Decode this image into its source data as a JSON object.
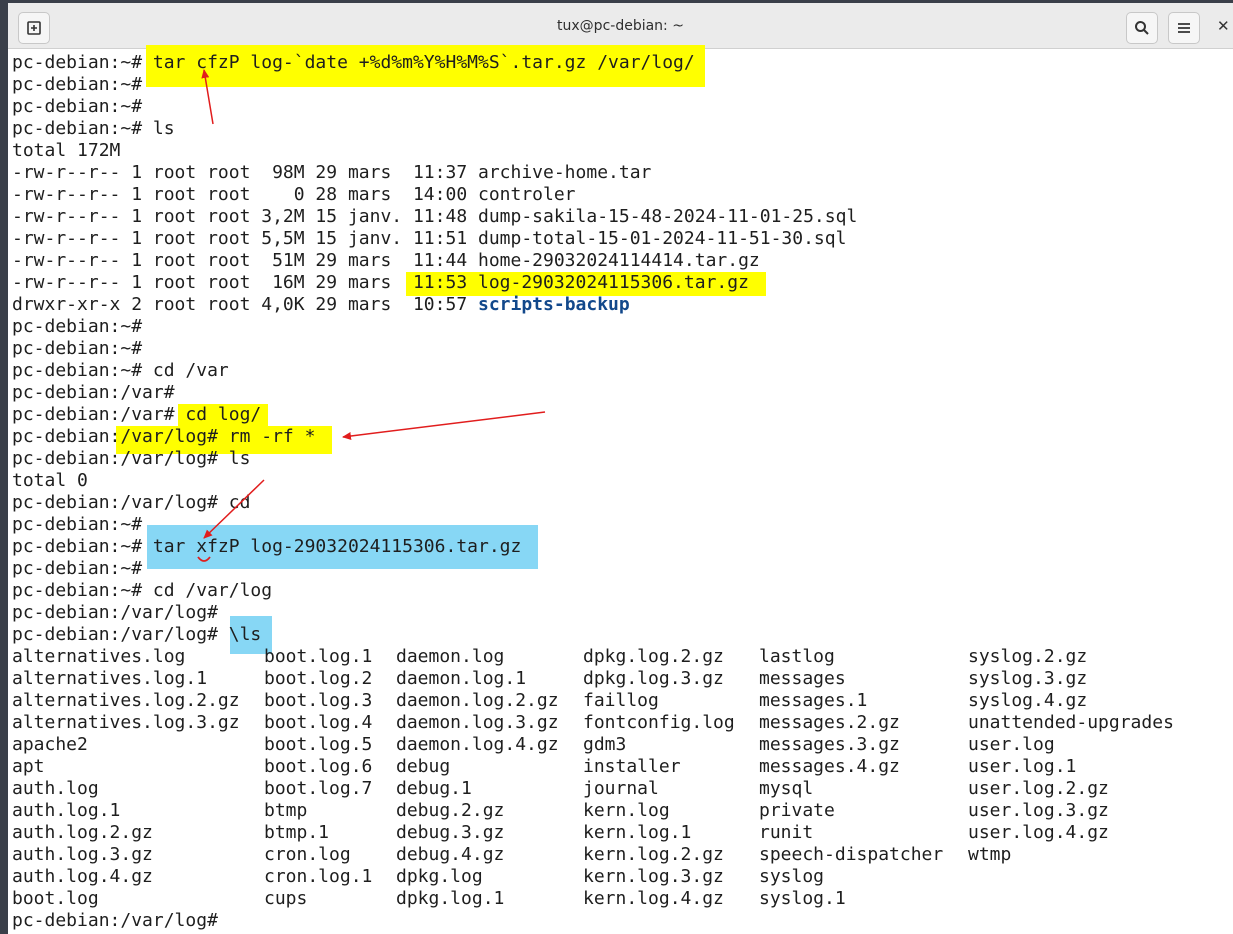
{
  "window": {
    "title": "tux@pc-debian: ~",
    "new_tab_icon": "new-tab-icon",
    "search_icon": "search-icon",
    "menu_icon": "hamburger-menu-icon",
    "close_glyph": "✕"
  },
  "colors": {
    "highlight_yellow": "#ffff00",
    "highlight_blue": "#87d7f5",
    "arrow_red": "#e11d1d",
    "directory_blue": "#12488b"
  },
  "lines": [
    "pc-debian:~# tar cfzP log-`date +%d%m%Y%H%M%S`.tar.gz /var/log/",
    "pc-debian:~#",
    "pc-debian:~#",
    "pc-debian:~# ls",
    "total 172M",
    "-rw-r--r-- 1 root root  98M 29 mars  11:37 archive-home.tar",
    "-rw-r--r-- 1 root root    0 28 mars  14:00 controler",
    "-rw-r--r-- 1 root root 3,2M 15 janv. 11:48 dump-sakila-15-48-2024-11-01-25.sql",
    "-rw-r--r-- 1 root root 5,5M 15 janv. 11:51 dump-total-15-01-2024-11-51-30.sql",
    "-rw-r--r-- 1 root root  51M 29 mars  11:44 home-29032024114414.tar.gz",
    "-rw-r--r-- 1 root root  16M 29 mars  11:53 log-29032024115306.tar.gz",
    "drwxr-xr-x 2 root root 4,0K 29 mars  10:57 ",
    "pc-debian:~#",
    "pc-debian:~#",
    "pc-debian:~# cd /var",
    "pc-debian:/var#",
    "pc-debian:/var# cd log/",
    "pc-debian:/var/log# rm -rf *",
    "pc-debian:/var/log# ls",
    "total 0",
    "pc-debian:/var/log# cd",
    "pc-debian:~#",
    "pc-debian:~# tar xfzP log-29032024115306.tar.gz",
    "pc-debian:~#",
    "pc-debian:~# cd /var/log",
    "pc-debian:/var/log#",
    "pc-debian:/var/log# \\ls"
  ],
  "dir_name": "scripts-backup",
  "listing": {
    "col1": [
      "alternatives.log",
      "alternatives.log.1",
      "alternatives.log.2.gz",
      "alternatives.log.3.gz",
      "apache2",
      "apt",
      "auth.log",
      "auth.log.1",
      "auth.log.2.gz",
      "auth.log.3.gz",
      "auth.log.4.gz",
      "boot.log"
    ],
    "col2": [
      "boot.log.1",
      "boot.log.2",
      "boot.log.3",
      "boot.log.4",
      "boot.log.5",
      "boot.log.6",
      "boot.log.7",
      "btmp",
      "btmp.1",
      "cron.log",
      "cron.log.1",
      "cups"
    ],
    "col3": [
      "daemon.log",
      "daemon.log.1",
      "daemon.log.2.gz",
      "daemon.log.3.gz",
      "daemon.log.4.gz",
      "debug",
      "debug.1",
      "debug.2.gz",
      "debug.3.gz",
      "debug.4.gz",
      "dpkg.log",
      "dpkg.log.1"
    ],
    "col4": [
      "dpkg.log.2.gz",
      "dpkg.log.3.gz",
      "faillog",
      "fontconfig.log",
      "gdm3",
      "installer",
      "journal",
      "kern.log",
      "kern.log.1",
      "kern.log.2.gz",
      "kern.log.3.gz",
      "kern.log.4.gz"
    ],
    "col5": [
      "lastlog",
      "messages",
      "messages.1",
      "messages.2.gz",
      "messages.3.gz",
      "messages.4.gz",
      "mysql",
      "private",
      "runit",
      "speech-dispatcher",
      "syslog",
      "syslog.1"
    ],
    "col6": [
      "syslog.2.gz",
      "syslog.3.gz",
      "syslog.4.gz",
      "unattended-upgrades",
      "user.log",
      "user.log.1",
      "user.log.2.gz",
      "user.log.3.gz",
      "user.log.4.gz",
      "wtmp",
      "",
      ""
    ]
  },
  "final_prompt": "pc-debian:/var/log#"
}
